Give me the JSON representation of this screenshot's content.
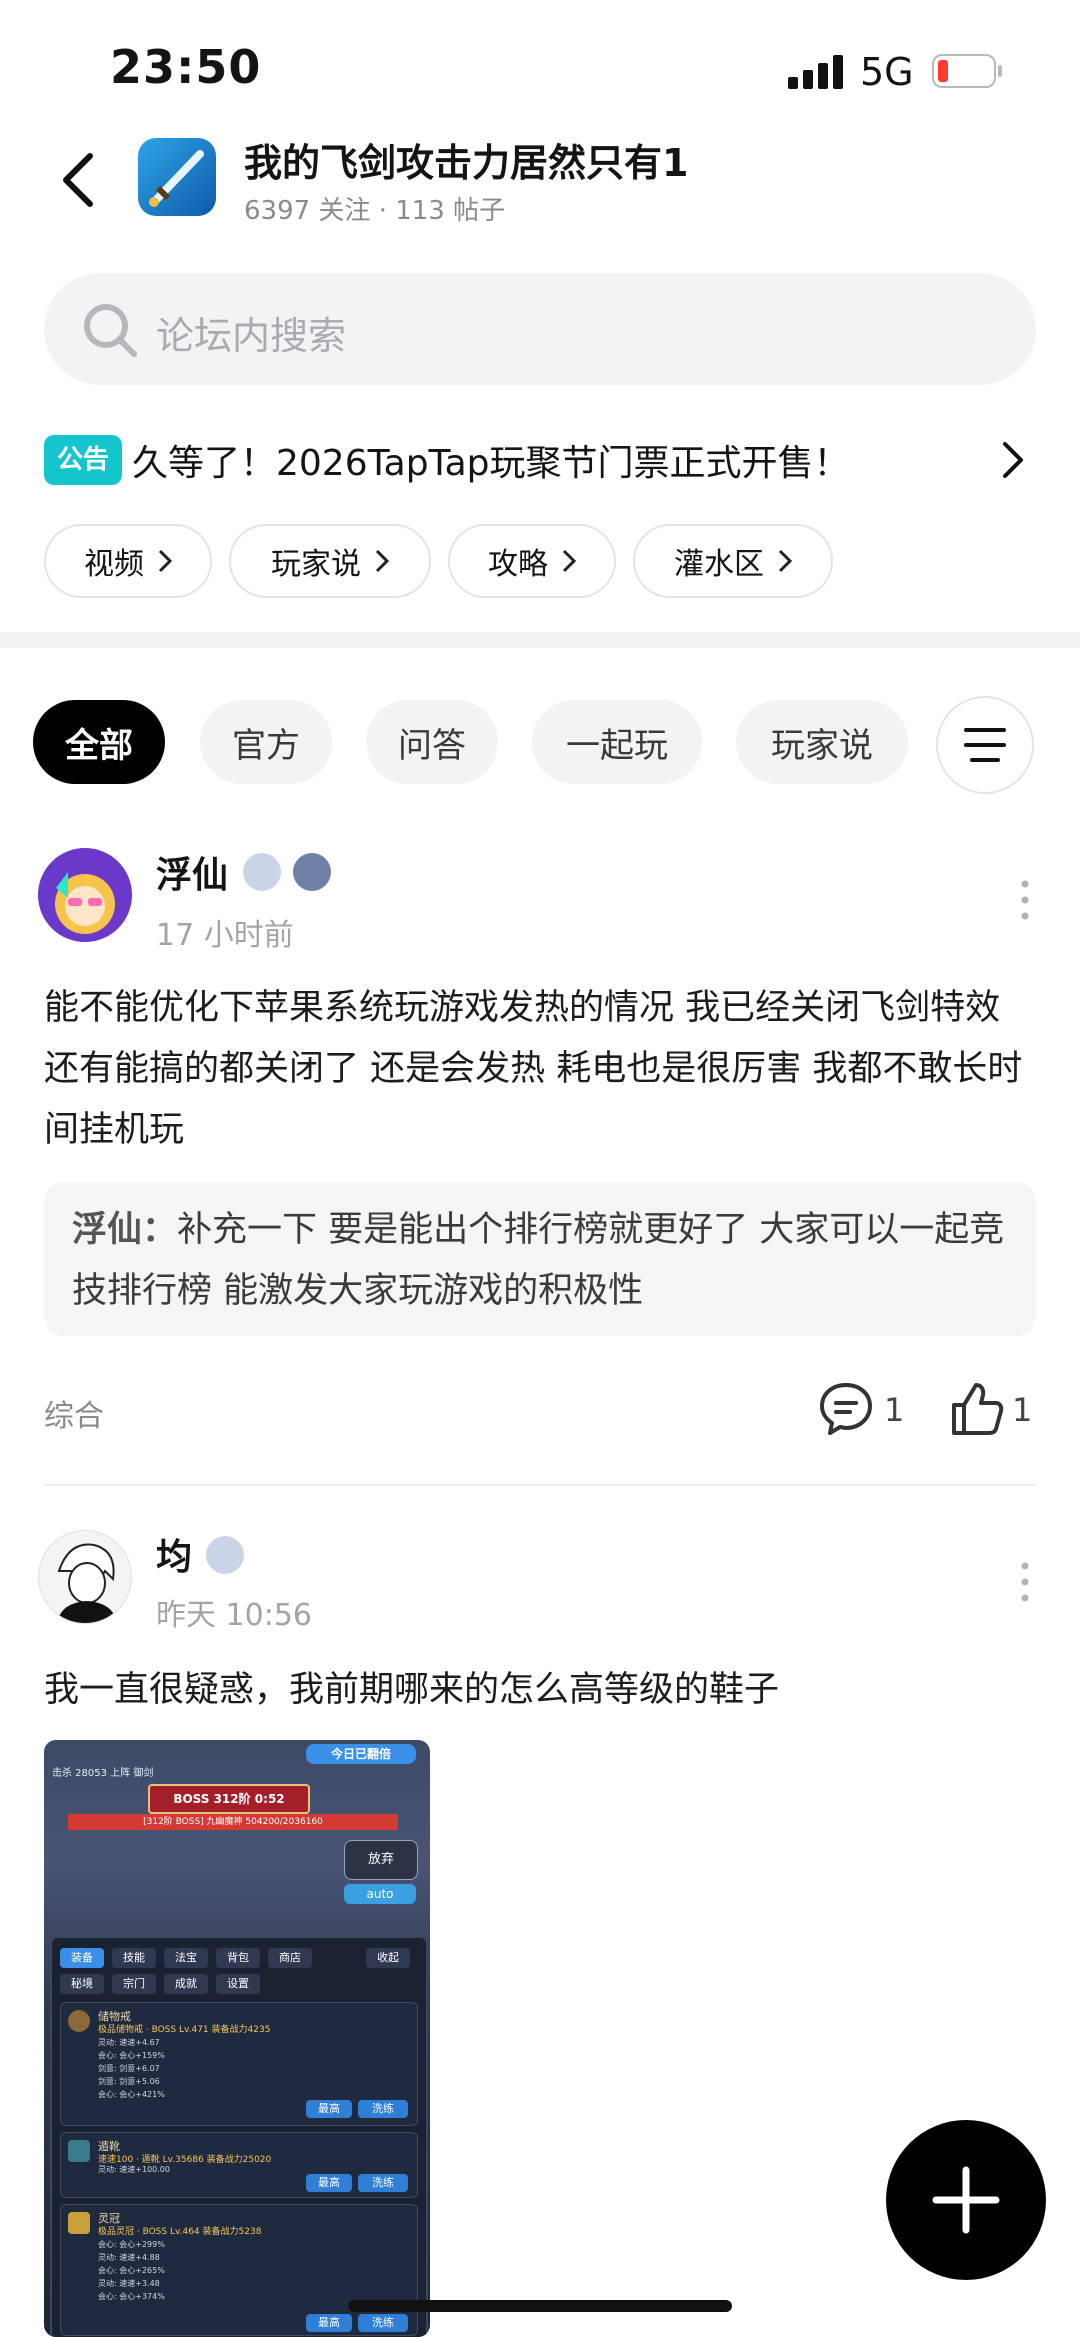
{
  "status_bar": {
    "time": "23:50",
    "network": "5G",
    "battery_color": "#ff3b30"
  },
  "header": {
    "title": "我的飞剑攻击力居然只有1",
    "subtitle": "6397 关注 · 113 帖子"
  },
  "search": {
    "placeholder": "论坛内搜索"
  },
  "notice": {
    "badge": "公告",
    "text": "久等了！2026TapTap玩聚节门票正式开售！"
  },
  "quick_chips": [
    "视频",
    "玩家说",
    "攻略",
    "灌水区"
  ],
  "filter_tabs": [
    "全部",
    "官方",
    "问答",
    "一起玩",
    "玩家说"
  ],
  "posts": [
    {
      "author": "浮仙",
      "time": "17 小时前",
      "body": "能不能优化下苹果系统玩游戏发热的情况 我已经关闭飞剑特效还有能搞的都关闭了 还是会发热 耗电也是很厉害 我都不敢长时间挂机玩",
      "quote_author": "浮仙：",
      "quote_text": "补充一下 要是能出个排行榜就更好了 大家可以一起竞技排行榜 能激发大家玩游戏的积极性",
      "tag": "综合",
      "comments": "1",
      "likes": "1"
    },
    {
      "author": "均",
      "time": "昨天 10:56",
      "body": "我一直很疑惑，我前期哪来的怎么高等级的鞋子",
      "image": {
        "top_left": "击杀 28053 上阵 御剑",
        "top_right_btn": "今日已翻倍",
        "boss_title": "BOSS 312阶 0:52",
        "boss_bar": "[312阶 BOSS] 九幽魔神 504200/2036160",
        "btn_giveup": "放弃",
        "btn_auto": "auto",
        "tabs_row1": [
          "装备",
          "技能",
          "法宝",
          "背包",
          "商店",
          "收起"
        ],
        "tabs_row2": [
          "秘境",
          "宗门",
          "成就",
          "设置"
        ],
        "items": [
          {
            "name": "储物戒",
            "desc": "极品储物戒 · BOSS Lv.471 装备战力4235",
            "lines": [
              "灵动: 速速+4.67",
              "会心: 会心+159%",
              "剑意: 剑意+6.07",
              "剑意: 剑意+5.06",
              "会心: 会心+421%"
            ],
            "btns": [
              "最高",
              "洗练"
            ]
          },
          {
            "name": "遁靴",
            "desc": "速速100 · 遁靴 Lv.35686 装备战力25020",
            "lines": [
              "灵动: 速速+100.00"
            ],
            "btns": [
              "最高",
              "洗练"
            ]
          },
          {
            "name": "灵冠",
            "desc": "极品灵冠 · BOSS Lv.464 装备战力5238",
            "lines": [
              "会心: 会心+299%",
              "灵动: 速速+4.88",
              "会心: 会心+265%",
              "灵动: 速速+3.48",
              "会心: 会心+374%"
            ],
            "btns": [
              "最高",
              "洗练"
            ]
          }
        ]
      }
    }
  ],
  "colors": {
    "notice_badge": "#15c5ce",
    "active_tab": "#000000",
    "fab": "#000000"
  },
  "icons": [
    "back-arrow-icon",
    "search-icon",
    "chevron-right-icon",
    "filter-menu-icon",
    "more-dots-icon",
    "comment-icon",
    "like-icon",
    "plus-icon"
  ]
}
